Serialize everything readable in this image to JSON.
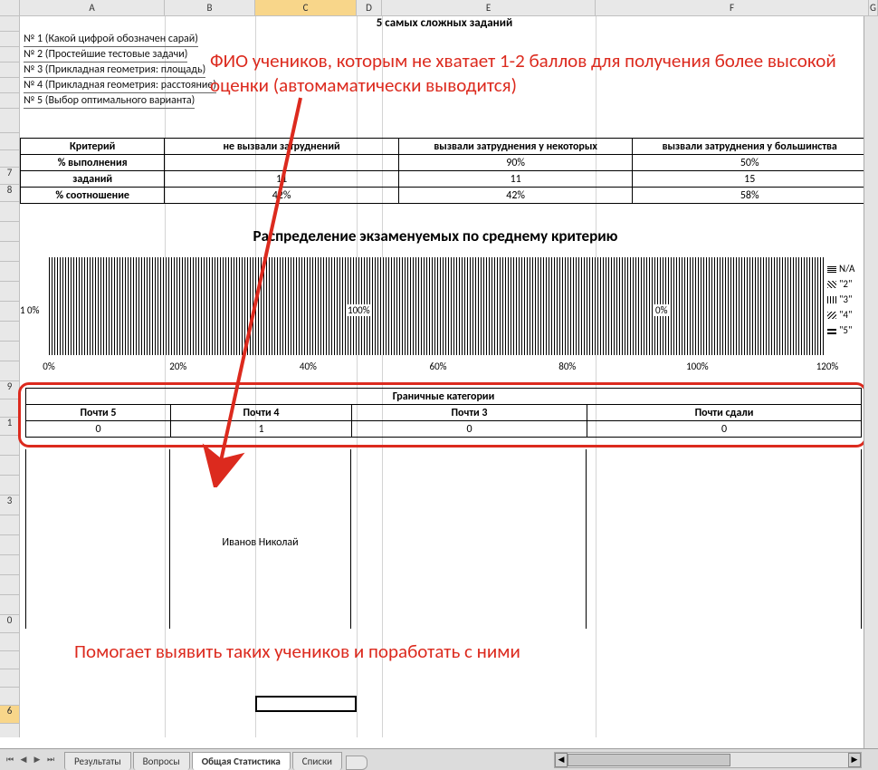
{
  "columns": [
    "A",
    "B",
    "C",
    "D",
    "E",
    "F",
    "G"
  ],
  "selected_column": "C",
  "title": "5   самых сложных заданий",
  "tasks": [
    "№ 1 (Какой цифрой обозначен сарай)",
    "№ 2 (Простейшие тестовые задачи)",
    "№ 3 (Прикладная геометрия: площадь)",
    "№ 4 (Прикладная геометрия: расстояние)",
    "№ 5 (Выбор оптимального варианта)"
  ],
  "criteria": {
    "headers": [
      "Критерий",
      "не вызвали затруднений",
      "вызвали затруднения у некоторых",
      "вызвали затруднения у большинства"
    ],
    "rows": [
      {
        "label": "% выполнения",
        "values": [
          "",
          "90%",
          "50%"
        ]
      },
      {
        "label": "заданий",
        "values": [
          "11",
          "11",
          "15"
        ]
      },
      {
        "label": "% соотношение",
        "values": [
          "42%",
          "42%",
          "58%"
        ]
      }
    ]
  },
  "chart_data": {
    "type": "bar",
    "title": "Распределение экзаменуемых по среднему критерию",
    "categories": [
      "1"
    ],
    "series": [
      {
        "name": "N/A",
        "values": [
          0
        ]
      },
      {
        "name": "\"2\"",
        "values": [
          0
        ]
      },
      {
        "name": "\"3\"",
        "values": [
          100
        ]
      },
      {
        "name": "\"4\"",
        "values": [
          0
        ]
      },
      {
        "name": "\"5\"",
        "values": [
          0
        ]
      }
    ],
    "labels_left": "1 0%",
    "label_center": "100%",
    "label_right": "0%",
    "xlabel": "",
    "ylabel": "",
    "xlim": [
      0,
      120
    ],
    "xticks": [
      "0%",
      "20%",
      "40%",
      "60%",
      "80%",
      "100%",
      "120%"
    ]
  },
  "boundary": {
    "title": "Граничные категории",
    "headers": [
      "Почти 5",
      "Почти 4",
      "Почти 3",
      "Почти сдали"
    ],
    "values": [
      "0",
      "1",
      "0",
      "0"
    ],
    "names": [
      "",
      "Иванов Николай",
      "",
      ""
    ]
  },
  "annotations": {
    "top": "ФИО учеников, которым не хватает 1-2 баллов для получения более высокой оценки (автомаматически выводится)",
    "bottom": "Помогает выявить таких учеников и поработать с ними"
  },
  "tabs": [
    "Результаты",
    "Вопросы",
    "Общая Статистика",
    "Списки"
  ],
  "active_tab": "Общая Статистика",
  "colors": {
    "annotation": "#dc2a1e",
    "border": "#000000"
  }
}
